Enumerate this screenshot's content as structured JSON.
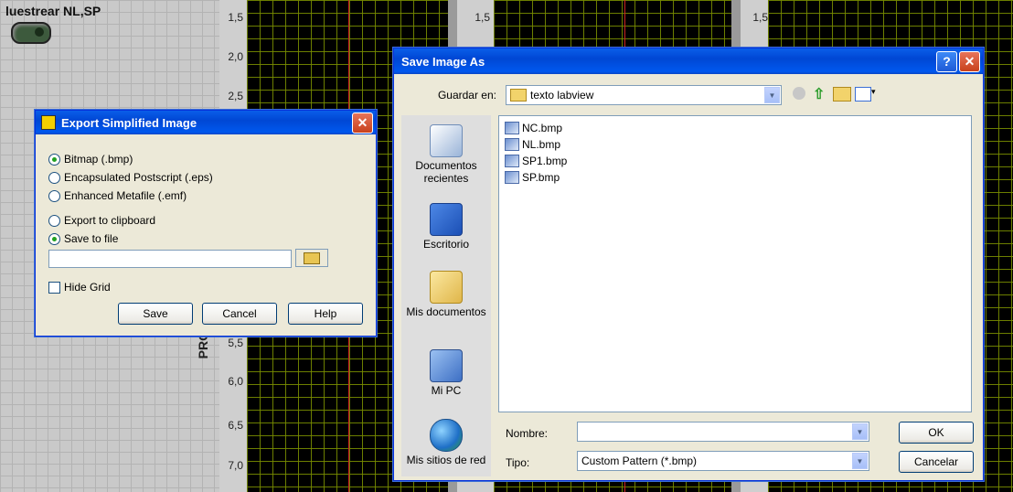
{
  "vi": {
    "title": "luestrear NL,SP",
    "y_ticks_left": [
      "1,5",
      "2,0",
      "2,5",
      "5,5",
      "6,0",
      "6,5",
      "7,0"
    ],
    "y_ticks_mid": "1,5",
    "y_ticks_right": "1,5",
    "ylabel": "PRO"
  },
  "export_dialog": {
    "title": "Export Simplified Image",
    "format_bmp": "Bitmap (.bmp)",
    "format_eps": "Encapsulated Postscript (.eps)",
    "format_emf": "Enhanced Metafile (.emf)",
    "dest_clipboard": "Export to clipboard",
    "dest_file": "Save to file",
    "path_value": "",
    "hide_grid": "Hide Grid",
    "save": "Save",
    "cancel": "Cancel",
    "help": "Help"
  },
  "save_dialog": {
    "title": "Save Image As",
    "save_in_label": "Guardar en:",
    "save_in_value": "texto labview",
    "places": [
      {
        "label": "Documentos recientes",
        "icon": "recent-documents-icon"
      },
      {
        "label": "Escritorio",
        "icon": "desktop-icon"
      },
      {
        "label": "Mis documentos",
        "icon": "my-documents-icon"
      },
      {
        "label": "Mi PC",
        "icon": "my-computer-icon"
      },
      {
        "label": "Mis sitios de red",
        "icon": "network-places-icon"
      }
    ],
    "files": [
      "NC.bmp",
      "NL.bmp",
      "SP1.bmp",
      "SP.bmp"
    ],
    "name_label": "Nombre:",
    "name_value": "",
    "type_label": "Tipo:",
    "type_value": "Custom Pattern (*.bmp)",
    "ok": "OK",
    "cancel": "Cancelar"
  },
  "colors": {
    "xp_title": "#0054e3",
    "plot_grid": "#788c00",
    "cursor": "#cc2222"
  }
}
